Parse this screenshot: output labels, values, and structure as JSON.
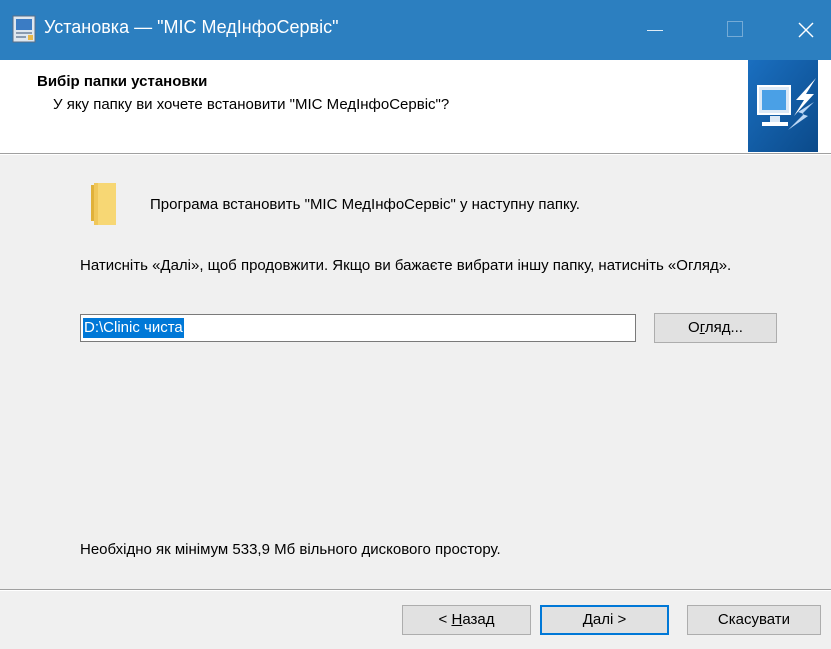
{
  "window": {
    "title": "Установка — \"МІС МедІнфоСервіс\""
  },
  "header": {
    "title": "Вибір папки установки",
    "subtitle": "У яку папку ви хочете встановити \"МІС МедІнфоСервіс\"?"
  },
  "main": {
    "intro": "Програма встановить \"МІС МедІнфоСервіс\" у наступну папку.",
    "instruction": "Натисніть «Далі», щоб продовжити. Якщо ви бажаєте вибрати іншу папку, натисніть «Огляд».",
    "path_value": "D:\\Clinic чиста",
    "browse": {
      "pre": "О",
      "underline": "г",
      "post": "ляд..."
    },
    "disk_space": "Необхідно як мінімум 533,9 Мб вільного дискового простору."
  },
  "footer": {
    "back": {
      "pre": "< ",
      "underline": "Н",
      "post": "азад"
    },
    "next": {
      "pre": "",
      "underline": "Д",
      "post": "алі >"
    },
    "cancel": "Скасувати"
  },
  "icons": {
    "app": "installer-app-icon",
    "minimize": "minimize-icon",
    "maximize": "maximize-icon",
    "close": "close-icon",
    "wizard": "computer-install-arrow-icon",
    "folder": "folder-icon"
  },
  "colors": {
    "titlebar": "#2c7fc0",
    "selection": "#0078d7",
    "default_button_border": "#0078d7"
  }
}
